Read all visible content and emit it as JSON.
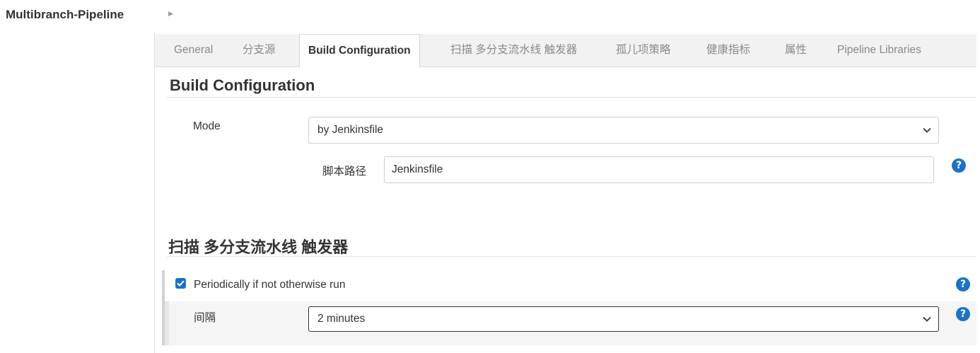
{
  "breadcrumb": {
    "title": "Multibranch-Pipeline",
    "arrow_icon": "chevron-right-icon"
  },
  "tabs": [
    {
      "label": "General",
      "active": false
    },
    {
      "label": "分支源",
      "active": false
    },
    {
      "label": "Build Configuration",
      "active": true
    },
    {
      "label": "扫描 多分支流水线 触发器",
      "active": false
    },
    {
      "label": "孤儿项策略",
      "active": false
    },
    {
      "label": "健康指标",
      "active": false
    },
    {
      "label": "属性",
      "active": false
    },
    {
      "label": "Pipeline Libraries",
      "active": false
    }
  ],
  "build_config": {
    "title": "Build Configuration",
    "mode_label": "Mode",
    "mode_value": "by Jenkinsfile",
    "script_path_label": "脚本路径",
    "script_path_value": "Jenkinsfile"
  },
  "scan_trigger": {
    "title": "扫描 多分支流水线 触发器",
    "periodic_label": "Periodically if not otherwise run",
    "periodic_checked": true,
    "interval_label": "间隔",
    "interval_value": "2 minutes"
  },
  "help_symbol": "?",
  "colors": {
    "accent": "#1a73c4",
    "tab_bar_bg": "#f2f2f2",
    "inactive_tab_text": "#8a8a8a"
  }
}
